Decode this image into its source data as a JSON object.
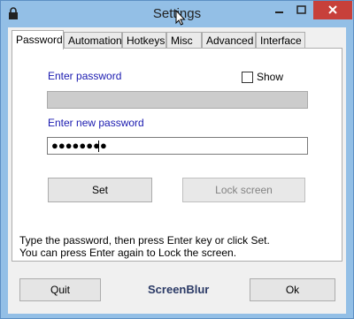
{
  "window": {
    "title": "Settings",
    "icon": "lock-icon",
    "controls": [
      "minimize-icon",
      "maximize-icon",
      "close-icon"
    ],
    "close_color": "#c7403a",
    "frame_color": "#93bfe6"
  },
  "tabs": [
    {
      "label": "Password",
      "active": true
    },
    {
      "label": "Automation",
      "active": false
    },
    {
      "label": "Hotkeys",
      "active": false
    },
    {
      "label": "Misc",
      "active": false
    },
    {
      "label": "Advanced",
      "active": false
    },
    {
      "label": "Interface",
      "active": false
    }
  ],
  "password_panel": {
    "enter_password_label": "Enter password",
    "show_label": "Show",
    "show_checked": false,
    "enter_password_value": "",
    "new_password_label": "Enter new password",
    "new_password_value": "●●●●●●●●",
    "set_button": "Set",
    "lock_button": "Lock screen",
    "info_line1": "Type the password, then press Enter key or click Set.",
    "info_line2": "You can press Enter again to Lock the screen."
  },
  "footer": {
    "quit_button": "Quit",
    "brand": "ScreenBlur",
    "ok_button": "Ok"
  }
}
